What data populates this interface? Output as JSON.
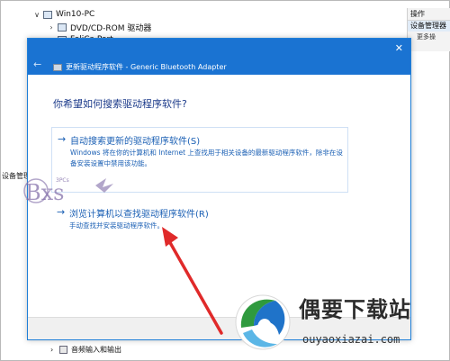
{
  "device_manager": {
    "tree": [
      {
        "label": "Win10-PC",
        "state": "expanded"
      },
      {
        "label": "DVD/CD-ROM 驱动器",
        "state": "collapsed"
      },
      {
        "label": "FeliCa Port",
        "state": "collapsed"
      }
    ],
    "actions": {
      "header": "操作",
      "item": "设备管理器",
      "more": "更多操"
    },
    "side_label": "设备管理器",
    "bottom_item": "音频输入和输出"
  },
  "dialog": {
    "title": "更新驱动程序软件 - Generic Bluetooth Adapter",
    "question": "你希望如何搜索驱动程序软件?",
    "options": [
      {
        "title": "自动搜索更新的驱动程序软件(S)",
        "desc": "Windows 将在你的计算机和 Internet 上查找用于相关设备的最新驱动程序软件，除非在设备安装设置中禁用该功能。"
      },
      {
        "title": "浏览计算机以查找驱动程序软件(R)",
        "desc": "手动查找并安装驱动程序软件。"
      }
    ]
  },
  "overlays": {
    "watermark_text": "Bxs",
    "watermark_small": "3PCs",
    "site_logo_cn": "偶要下载站",
    "site_logo_url": "ouyaoxiazai.com",
    "arrow_color": "#e02a2a"
  }
}
